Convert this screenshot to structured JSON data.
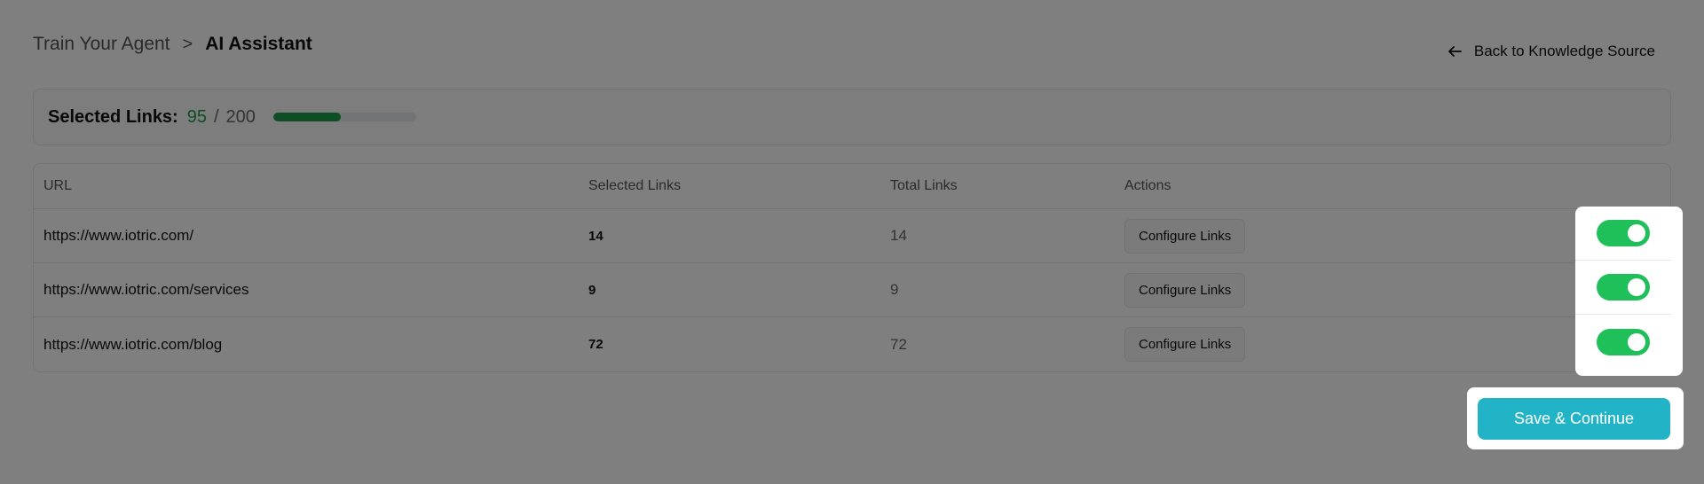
{
  "breadcrumb": {
    "parent": "Train Your Agent",
    "separator": ">",
    "current": "AI Assistant"
  },
  "header": {
    "back_label": "Back to Knowledge Source"
  },
  "summary": {
    "label": "Selected Links:",
    "selected": "95",
    "slash": "/",
    "total": "200",
    "progress_fraction": 0.475
  },
  "table": {
    "columns": [
      "URL",
      "Selected Links",
      "Total Links",
      "Actions"
    ],
    "rows": [
      {
        "url": "https://www.iotric.com/",
        "selected": "14",
        "total": "14",
        "action": "Configure Links",
        "enabled": true
      },
      {
        "url": "https://www.iotric.com/services",
        "selected": "9",
        "total": "9",
        "action": "Configure Links",
        "enabled": true
      },
      {
        "url": "https://www.iotric.com/blog",
        "selected": "72",
        "total": "72",
        "action": "Configure Links",
        "enabled": true
      }
    ]
  },
  "footer": {
    "save_label": "Save & Continue"
  },
  "colors": {
    "accent": "#22b4c6",
    "success": "#1f9d49",
    "toggle_on": "#1fbf5a",
    "overlay": "rgba(0,0,0,0.5)"
  },
  "icons": {
    "back": "arrow-left-icon"
  }
}
